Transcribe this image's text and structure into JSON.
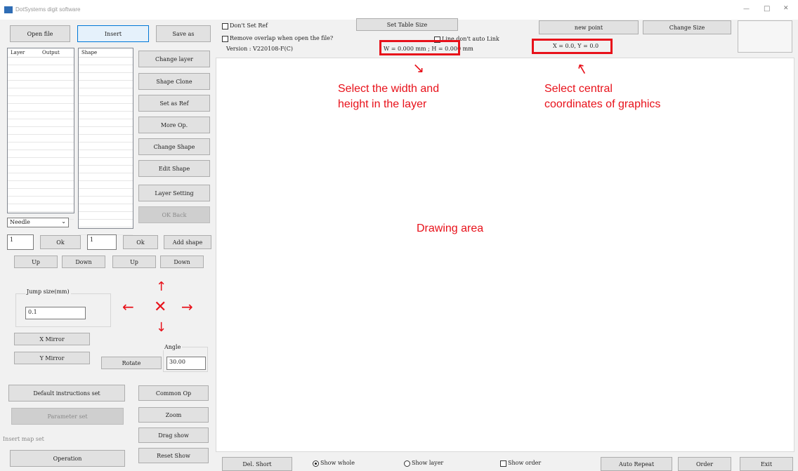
{
  "window": {
    "title": "DotSystems digit software",
    "minimize": "—",
    "maximize": "□",
    "close": "✕"
  },
  "left": {
    "open_file": "Open file",
    "insert": "Insert",
    "save_as": "Save as",
    "layer_header": "Layer",
    "output_header": "Output",
    "shape_header": "Shape",
    "change_layer": "Change layer",
    "shape_clone": "Shape Clone",
    "set_as_ref": "Set as Ref",
    "more_op": "More Op.",
    "change_shape": "Change Shape",
    "edit_shape": "Edit Shape",
    "layer_setting": "Layer Setting",
    "ok_back": "OK Back",
    "tool_select": "Needle",
    "layer_num": "1",
    "ok1": "Ok",
    "shape_num": "1",
    "ok2": "Ok",
    "add_shape": "Add shape",
    "up1": "Up",
    "down1": "Down",
    "up2": "Up",
    "down2": "Down",
    "jump_label": "Jump size(mm)",
    "jump_value": "0.1",
    "x_mirror": "X Mirror",
    "y_mirror": "Y Mirror",
    "rotate": "Rotate",
    "angle_label": "Angle",
    "angle_value": "30.00",
    "default_instructions": "Default instructions set",
    "parameter_set": "Parameter set",
    "common_op": "Common Op",
    "zoom": "Zoom",
    "drag_show": "Drag show",
    "insert_map": "Insert map set",
    "operation": "Operation",
    "reset_show": "Reset Show"
  },
  "top": {
    "dont_set_ref": "Don't Set Ref",
    "remove_overlap": "Remove overlap when open the file?",
    "version": "Version :  V220108-F(C)",
    "set_table_size": "Set Table Size",
    "line_auto_link": "Line don't auto Link",
    "wh_readout": "W = 0.000 mm ; H = 0.000 mm",
    "new_point": "new point",
    "change_size": "Change Size",
    "xy_readout": "X = 0.0, Y = 0.0"
  },
  "annotations": {
    "wh": "Select the width and\nheight in the layer",
    "xy": "Select central\ncoordinates of graphics",
    "drawing": "Drawing area"
  },
  "bottom": {
    "del_short": "Del. Short",
    "show_whole": "Show whole",
    "show_layer": "Show layer",
    "show_order": "Show order",
    "auto_repeat": "Auto Repeat",
    "order": "Order",
    "exit": "Exit"
  },
  "colors": {
    "annotation": "#e8111a",
    "active_border": "#0078d7"
  }
}
